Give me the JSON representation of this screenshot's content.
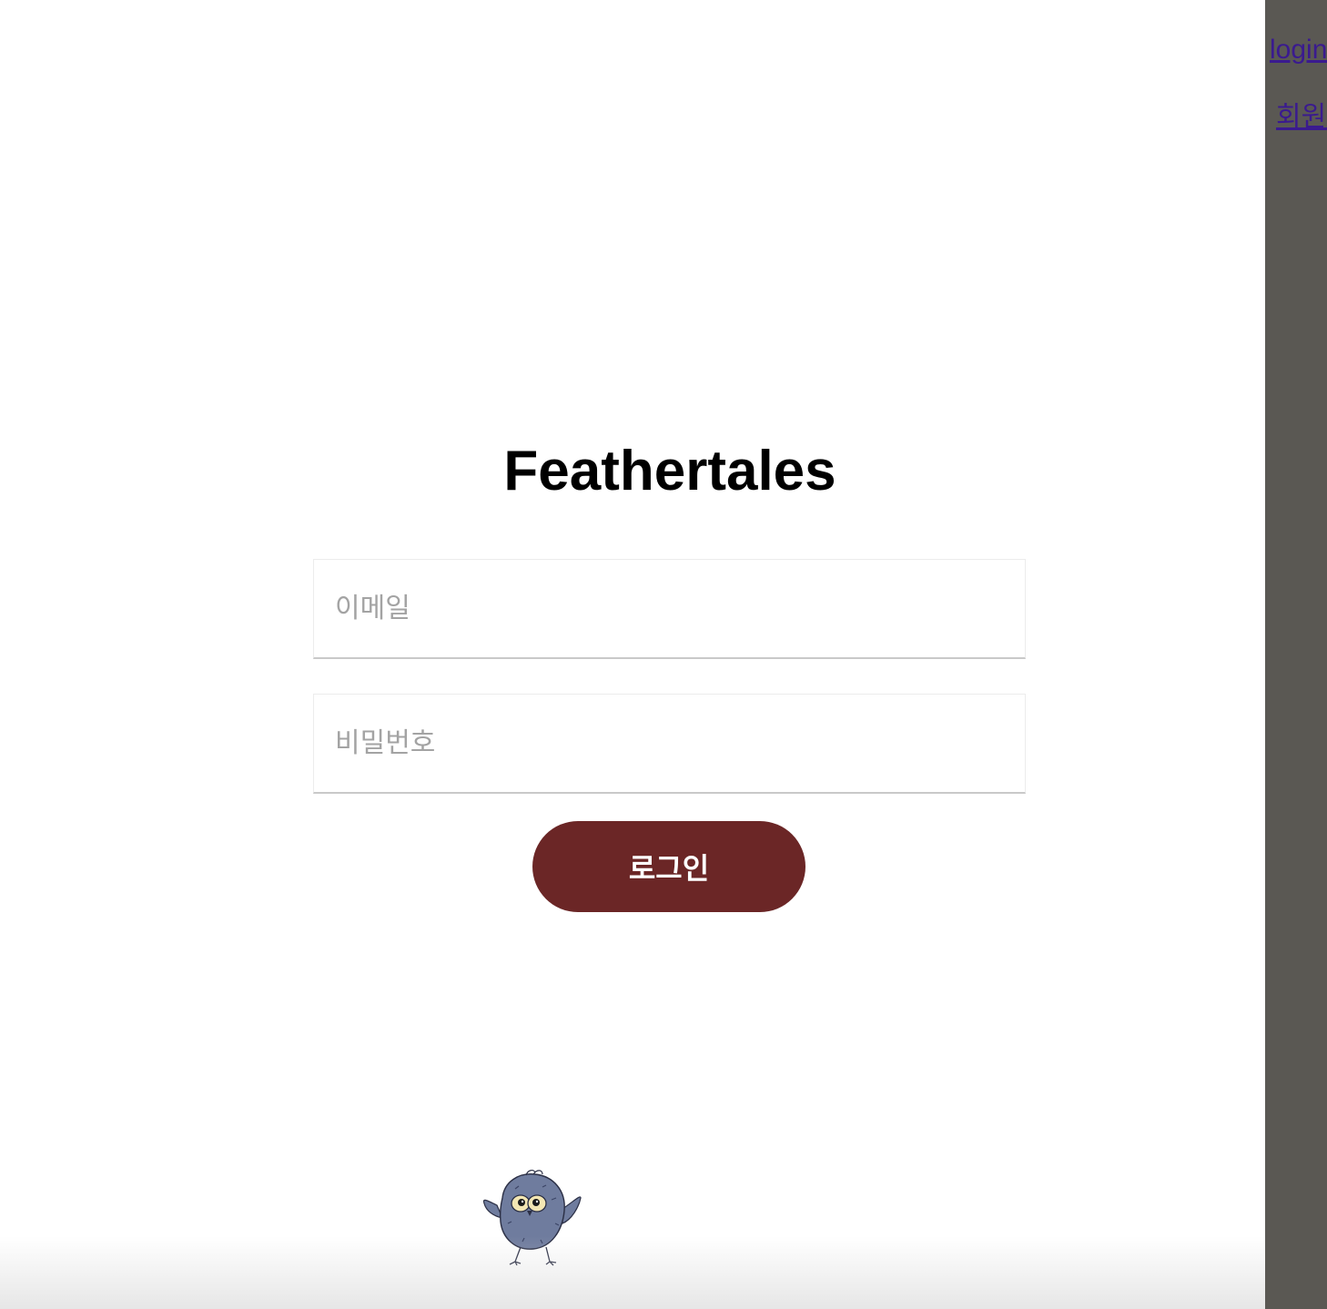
{
  "app": {
    "title": "Feathertales"
  },
  "sidebar": {
    "login_link": "login",
    "signup_link": "회원가입"
  },
  "form": {
    "email_placeholder": "이메일",
    "password_placeholder": "비밀번호",
    "submit_label": "로그인",
    "submit_color": "#6b2626"
  },
  "mascot": {
    "icon": "owl-mascot-icon"
  },
  "colors": {
    "sidebar_bg": "#5a5853",
    "link": "#3a1a8f",
    "owl_body": "#6f7c9e"
  }
}
